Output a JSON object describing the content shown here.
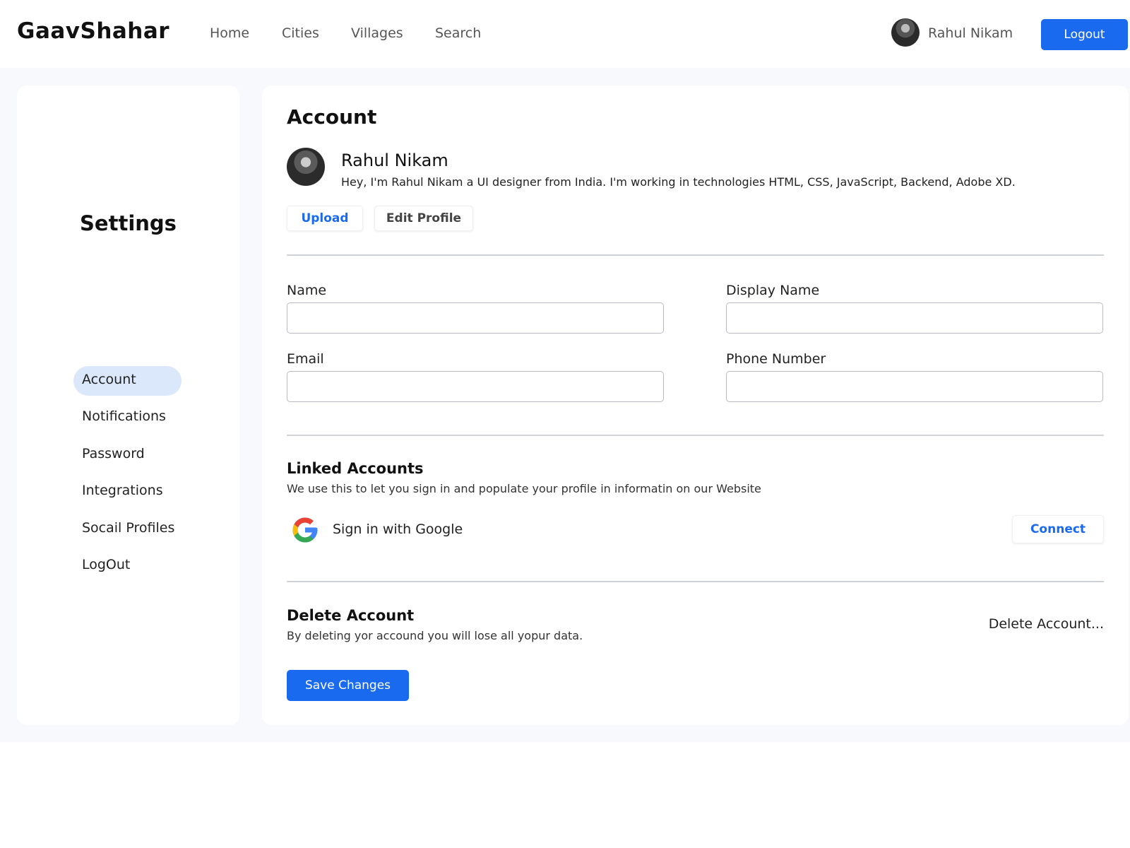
{
  "navbar": {
    "brand": "GaavShahar",
    "links": [
      "Home",
      "Cities",
      "Villages",
      "Search"
    ],
    "user_name": "Rahul Nikam",
    "logout_label": "Logout"
  },
  "sidebar": {
    "title": "Settings",
    "items": [
      "Account",
      "Notifications",
      "Password",
      "Integrations",
      "Socail Profiles",
      "LogOut"
    ],
    "active_item": "Account"
  },
  "account": {
    "title": "Account",
    "profile_name": "Rahul Nikam",
    "bio": "Hey, I'm Rahul Nikam a UI designer from India. I'm working in technologies HTML, CSS, JavaScript, Backend, Adobe XD.",
    "upload_label": "Upload",
    "edit_profile_label": "Edit Profile",
    "fields": {
      "name_label": "Name",
      "name_value": "",
      "display_name_label": "Display Name",
      "display_name_value": "",
      "email_label": "Email",
      "email_value": "",
      "phone_label": "Phone Number",
      "phone_value": ""
    }
  },
  "linked_accounts": {
    "title": "Linked Accounts",
    "description": "We use this to let you sign in and populate your profile in informatin on our Website",
    "google_label": "Sign in with Google",
    "google_icon": "google-icon",
    "connect_label": "Connect"
  },
  "delete_account": {
    "title": "Delete Account",
    "description": "By deleting yor accound you will lose all yopur data.",
    "link_label": "Delete Account..."
  },
  "save_label": "Save Changes",
  "colors": {
    "accent": "#1a6af0",
    "active_nav_bg": "#dbe8fb",
    "page_bg": "#f7f9fc"
  }
}
